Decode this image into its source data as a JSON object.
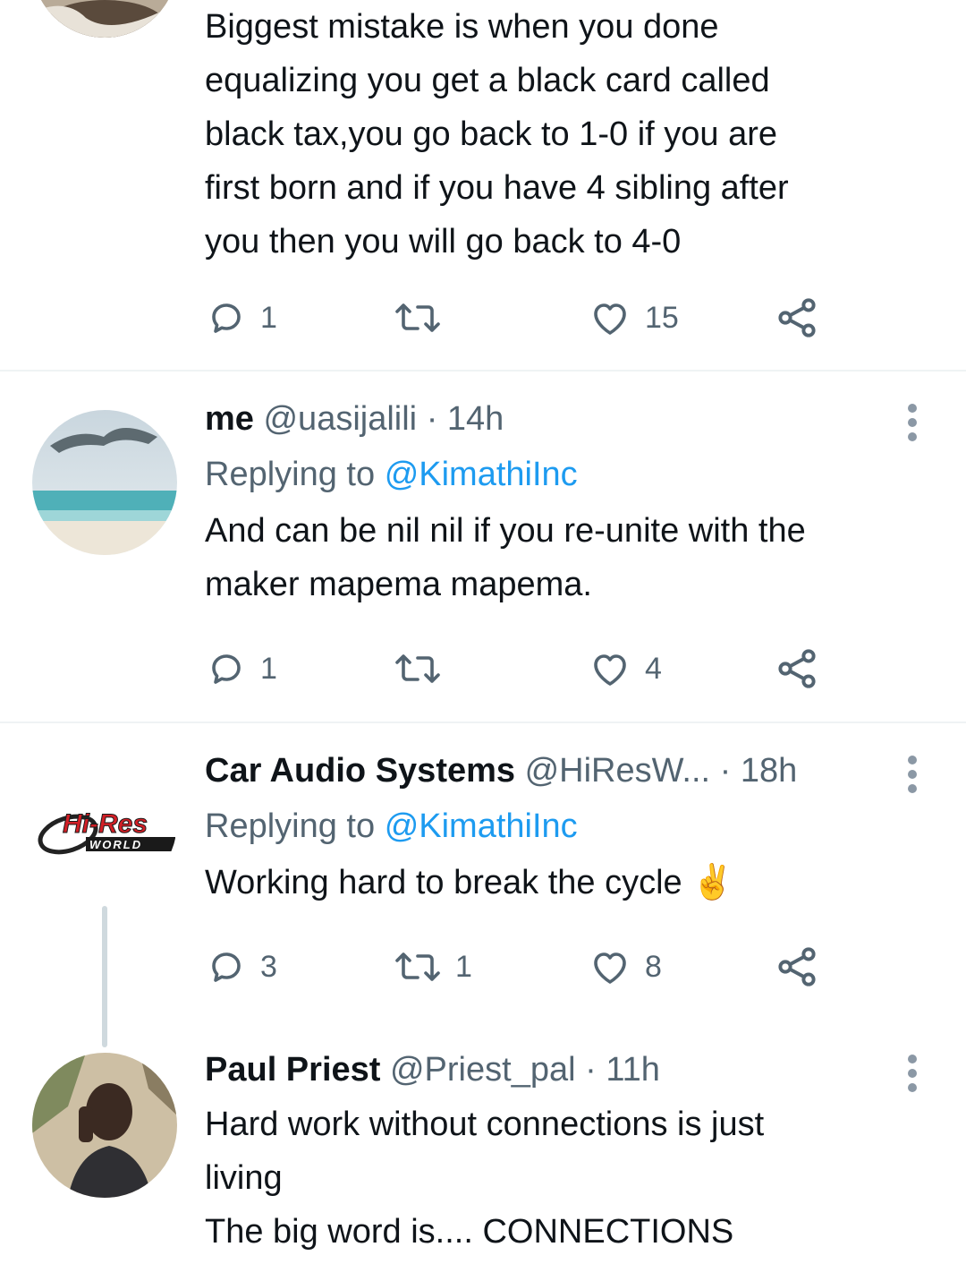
{
  "tweets": [
    {
      "body_lines": [
        "Biggest mistake is when you done",
        "equalizing you get a black card called",
        "black tax,you go back to 1-0 if you are",
        "first born and  if you have  4 sibling after",
        "you then you will go back to 4-0"
      ],
      "reply_count": "1",
      "retweet_count": "",
      "like_count": "15"
    },
    {
      "name": "me",
      "handle": "@uasijalili",
      "dot": "·",
      "time": "14h",
      "replying_prefix": "Replying to",
      "replying_mention": "@KimathiInc",
      "body_lines": [
        "And can be nil nil if you re-unite with the",
        "maker mapema mapema."
      ],
      "reply_count": "1",
      "retweet_count": "",
      "like_count": "4"
    },
    {
      "name": "Car Audio Systems",
      "handle": "@HiResW...",
      "dot": "·",
      "time": "18h",
      "replying_prefix": "Replying to",
      "replying_mention": "@KimathiInc",
      "body_lines": [
        "Working hard to break the cycle"
      ],
      "emoji": "✌️",
      "avatar_logo_top": "Hi-Res",
      "avatar_logo_bottom": "WORLD",
      "reply_count": "3",
      "retweet_count": "1",
      "like_count": "8"
    },
    {
      "name": "Paul Priest",
      "handle": "@Priest_pal",
      "dot": "·",
      "time": "11h",
      "body_lines": [
        "Hard work without connections is just",
        "living",
        "The big word is.... CONNECTIONS"
      ]
    }
  ],
  "icons": {
    "reply": "reply-icon",
    "retweet": "retweet-icon",
    "like": "heart-icon",
    "share": "share-icon",
    "more": "more-icon"
  },
  "colors": {
    "link": "#1d9bf0",
    "muted": "#536471",
    "text": "#0f1419",
    "divider": "#eff3f4"
  }
}
